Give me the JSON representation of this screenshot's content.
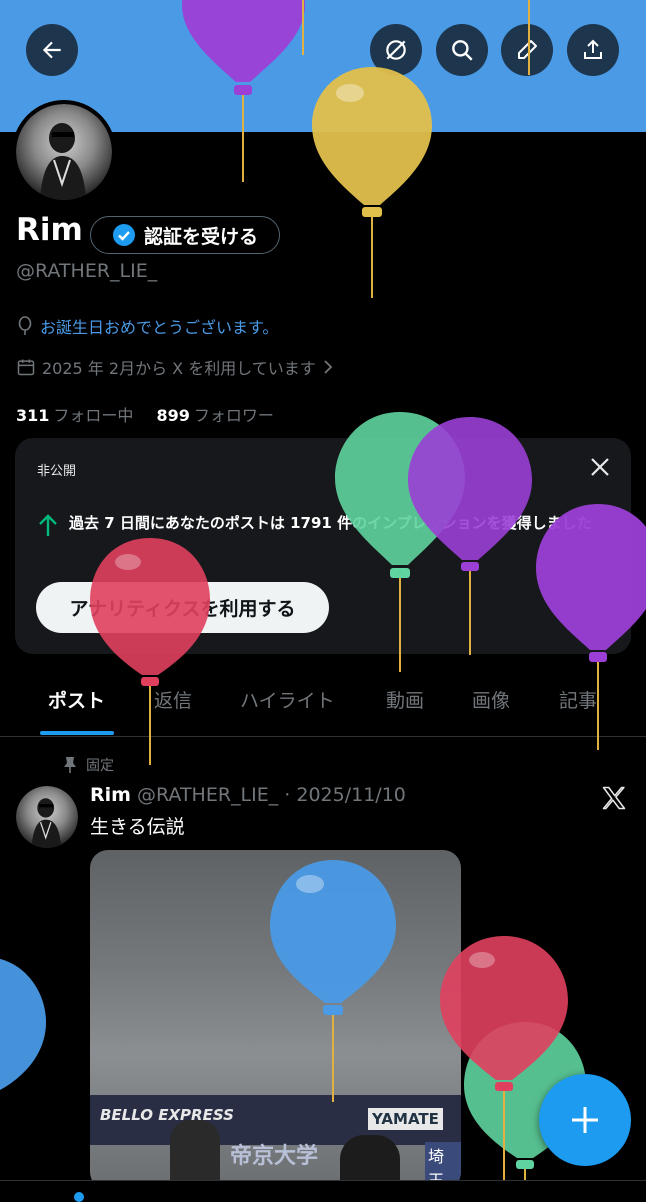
{
  "profile": {
    "name": "Rim",
    "verify_label": "認証を受ける",
    "handle": "@RATHER_LIE_",
    "birthday_text": "お誕生日おめでとうございます。",
    "joined_text": "2025 年 2月から X を利用しています",
    "following_count": "311",
    "following_label": "フォロー中",
    "followers_count": "899",
    "followers_label": "フォロワー"
  },
  "analytics_card": {
    "private_label": "非公開",
    "message": "過去 7 日間にあなたのポストは 1791 件のインプレッションを獲得しました",
    "button_label": "アナリティクスを利用する"
  },
  "tabs": [
    {
      "label": "ポスト",
      "active": true
    },
    {
      "label": "返信",
      "active": false
    },
    {
      "label": "ハイライト",
      "active": false
    },
    {
      "label": "動画",
      "active": false
    },
    {
      "label": "画像",
      "active": false
    },
    {
      "label": "記事",
      "active": false
    }
  ],
  "pinned_post": {
    "pinned_label": "固定",
    "author_name": "Rim",
    "author_handle": "@RATHER_LIE_",
    "date": "· 2025/11/10",
    "text": "生きる伝説",
    "media_signs": [
      "BELLO EXPRESS",
      "YAMATE",
      "帝京大学",
      "埼玉り"
    ]
  },
  "icons": {
    "back": "arrow-left-icon",
    "grok": "grok-icon",
    "search": "search-icon",
    "edit": "pencil-icon",
    "share": "share-icon",
    "balloon": "balloon-icon",
    "calendar": "calendar-icon",
    "close": "close-icon",
    "arrow_up": "arrow-up-icon",
    "pin": "pin-icon",
    "x_logo": "x-logo-icon",
    "compose": "plus-icon"
  },
  "colors": {
    "accent": "#1d9bf0",
    "banner": "#4a9ae6",
    "background": "#000000",
    "card": "#16181c",
    "positive": "#00ba7c"
  }
}
